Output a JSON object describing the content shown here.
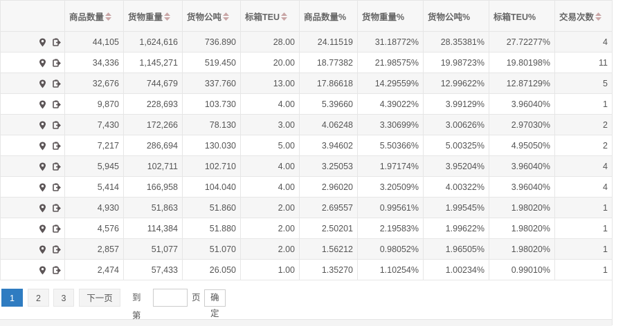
{
  "table": {
    "columns": [
      "",
      "商品数量",
      "货物重量",
      "货物公吨",
      "标箱TEU",
      "商品数量%",
      "货物重量%",
      "货物公吨%",
      "标箱TEU%",
      "交易次数"
    ],
    "rows": [
      [
        "44,105",
        "1,624,616",
        "736.890",
        "28.00",
        "24.11519",
        "31.18772%",
        "28.35381%",
        "27.72277%",
        "4"
      ],
      [
        "34,336",
        "1,145,271",
        "519.450",
        "20.00",
        "18.77382",
        "21.98575%",
        "19.98723%",
        "19.80198%",
        "11"
      ],
      [
        "32,676",
        "744,679",
        "337.760",
        "13.00",
        "17.86618",
        "14.29559%",
        "12.99622%",
        "12.87129%",
        "5"
      ],
      [
        "9,870",
        "228,693",
        "103.730",
        "4.00",
        "5.39660",
        "4.39022%",
        "3.99129%",
        "3.96040%",
        "1"
      ],
      [
        "7,430",
        "172,266",
        "78.130",
        "3.00",
        "4.06248",
        "3.30699%",
        "3.00626%",
        "2.97030%",
        "2"
      ],
      [
        "7,217",
        "286,694",
        "130.030",
        "5.00",
        "3.94602",
        "5.50366%",
        "5.00325%",
        "4.95050%",
        "2"
      ],
      [
        "5,945",
        "102,711",
        "102.710",
        "4.00",
        "3.25053",
        "1.97174%",
        "3.95204%",
        "3.96040%",
        "4"
      ],
      [
        "5,414",
        "166,958",
        "104.040",
        "4.00",
        "2.96020",
        "3.20509%",
        "4.00322%",
        "3.96040%",
        "4"
      ],
      [
        "4,930",
        "51,863",
        "51.860",
        "2.00",
        "2.69557",
        "0.99561%",
        "1.99545%",
        "1.98020%",
        "1"
      ],
      [
        "4,576",
        "114,384",
        "51.880",
        "2.00",
        "2.50201",
        "2.19583%",
        "1.99622%",
        "1.98020%",
        "1"
      ],
      [
        "2,857",
        "51,077",
        "51.070",
        "2.00",
        "1.56212",
        "0.98052%",
        "1.96505%",
        "1.98020%",
        "1"
      ],
      [
        "2,474",
        "57,433",
        "26.050",
        "1.00",
        "1.35270",
        "1.10254%",
        "1.00234%",
        "0.99010%",
        "1"
      ]
    ],
    "sortable_columns": [
      1,
      2,
      3,
      4,
      9
    ],
    "row_icons": [
      "map-pin-icon",
      "export-icon"
    ]
  },
  "pagination": {
    "pages": [
      "1",
      "2",
      "3"
    ],
    "current": "1",
    "next_label": "下一页",
    "goto_label": "到第",
    "page_unit": "页",
    "goto_value": "",
    "confirm_label": "确定"
  },
  "colors": {
    "accent": "#2f7cc1",
    "header_bg": "#f7f7f7",
    "stripe": "#f6f6f6",
    "icon": "#5c5557",
    "sort": "#c9a6a6"
  }
}
